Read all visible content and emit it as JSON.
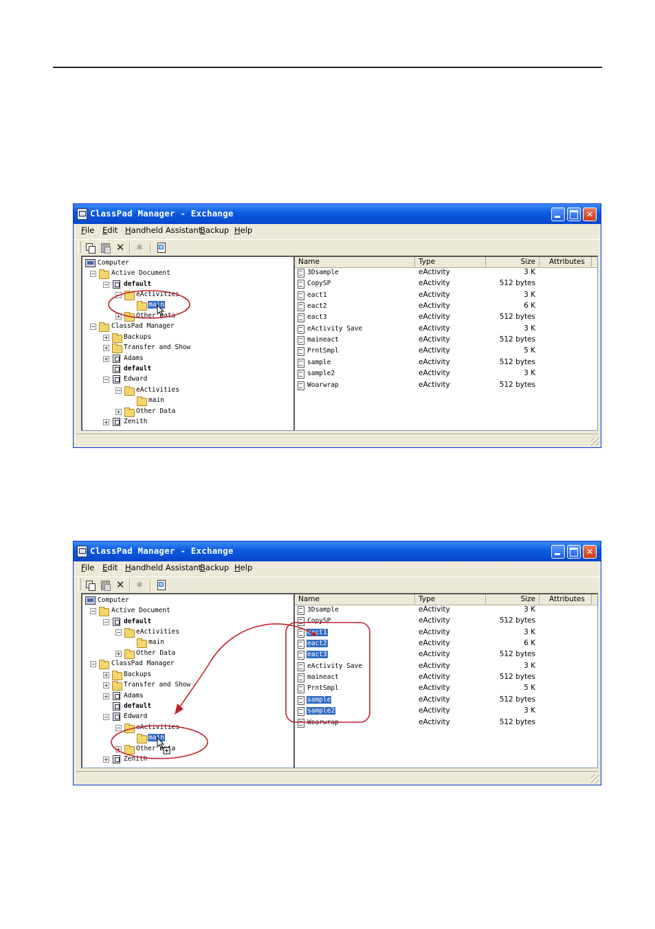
{
  "window": {
    "title": "ClassPad Manager - Exchange",
    "menu": [
      {
        "key": "F",
        "rest": "ile"
      },
      {
        "key": "E",
        "rest": "dit"
      },
      {
        "key": "H",
        "rest": "andheld Assistant"
      },
      {
        "key": "B",
        "rest": "ackup"
      },
      {
        "key": "H",
        "rest": "elp"
      }
    ],
    "toolbar": {
      "copy": "copy-icon",
      "paste": "paste-icon",
      "delete": "✕",
      "disabled": "✱",
      "properties": "properties-icon"
    }
  },
  "tree": {
    "computer": "Computer",
    "active_document": "Active Document",
    "default": "default",
    "eactivities": "eActivities",
    "main": "main",
    "other_data": "Other Data",
    "classpad_manager": "ClassPad Manager",
    "backups": "Backups",
    "transfer_and_show": "Transfer and Show",
    "adams": "Adams",
    "edward": "Edward",
    "zenith": "Zenith"
  },
  "columns": {
    "name": "Name",
    "type": "Type",
    "size": "Size",
    "attributes": "Attributes"
  },
  "files": [
    {
      "name": "3Dsample",
      "type": "eActivity",
      "size": "3 K"
    },
    {
      "name": "CopySP",
      "type": "eActivity",
      "size": "512 bytes"
    },
    {
      "name": "eact1",
      "type": "eActivity",
      "size": "3 K"
    },
    {
      "name": "eact2",
      "type": "eActivity",
      "size": "6 K"
    },
    {
      "name": "eact3",
      "type": "eActivity",
      "size": "512 bytes"
    },
    {
      "name": "eActivity Save",
      "type": "eActivity",
      "size": "3 K"
    },
    {
      "name": "maineact",
      "type": "eActivity",
      "size": "512 bytes"
    },
    {
      "name": "PrntSmpl",
      "type": "eActivity",
      "size": "5 K"
    },
    {
      "name": "sample",
      "type": "eActivity",
      "size": "512 bytes"
    },
    {
      "name": "sample2",
      "type": "eActivity",
      "size": "3 K"
    },
    {
      "name": "Woarwrap",
      "type": "eActivity",
      "size": "512 bytes"
    }
  ],
  "colors": {
    "title_bar": "#0a5ae0",
    "selection": "#316ac5",
    "annotation": "#c0202a"
  }
}
